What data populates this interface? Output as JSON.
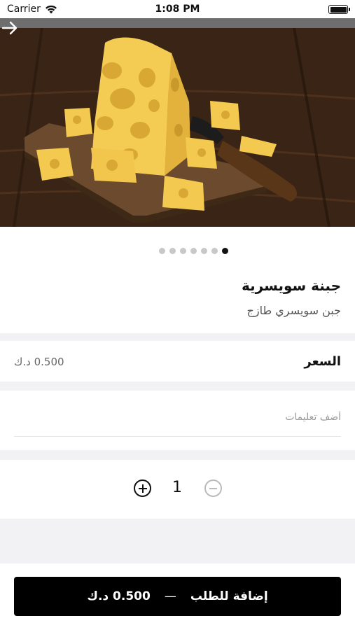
{
  "status_bar": {
    "carrier": "Carrier",
    "time": "1:08 PM"
  },
  "icons": {
    "wifi": "wifi-icon",
    "battery": "battery-icon",
    "next": "arrow-right-icon",
    "plus": "plus-circle-icon",
    "minus": "minus-circle-icon"
  },
  "carousel": {
    "slide_count": 7,
    "active_index": 6
  },
  "product": {
    "name": "جبنة سويسرية",
    "description": "جبن سويسري طازج"
  },
  "price": {
    "label": "السعر",
    "value": "0.500 د.ك"
  },
  "notes": {
    "placeholder": "أضف تعليمات",
    "value": ""
  },
  "quantity": {
    "value": "1"
  },
  "add_button": {
    "label": "إضافة للطلب",
    "separator": "—",
    "total": "0.500 د.ك"
  },
  "colors": {
    "button_bg": "#000000",
    "separator_bg": "#f2f2f4",
    "inactive_dot": "#c8c8c8"
  }
}
